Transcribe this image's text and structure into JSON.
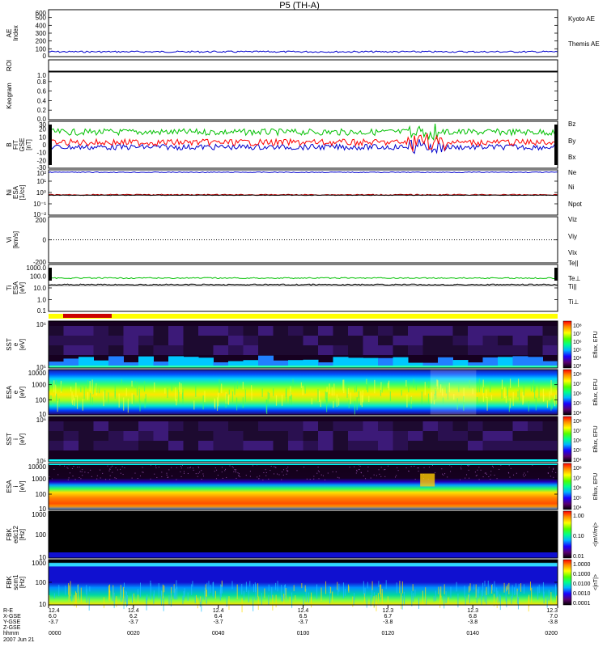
{
  "title": "P5 (TH-A)",
  "chart_data": {
    "type": "multi-panel",
    "panels": [
      {
        "id": "ae",
        "ylabel": "AE Index",
        "yticks": [
          "600",
          "500",
          "400",
          "300",
          "200",
          "100",
          "0"
        ],
        "ylim": [
          0,
          600
        ],
        "legend": [
          {
            "label": "Kyoto AE",
            "color": "#0000cc"
          },
          {
            "label": "Themis AE",
            "color": "#000000"
          }
        ]
      },
      {
        "id": "roi",
        "ylabel": "ROI",
        "yticks": [],
        "legend": []
      },
      {
        "id": "keogram",
        "ylabel": "Keogram",
        "yticks": [
          "1.0",
          "0.8",
          "0.6",
          "0.4",
          "0.2",
          "0.0"
        ],
        "ylim": [
          0,
          1
        ],
        "legend": []
      },
      {
        "id": "bfgm",
        "ylabel": "B FIT GSE [nT]",
        "yticks": [
          "30",
          "20",
          "10",
          "0",
          "-10",
          "-20",
          "-30"
        ],
        "ylim": [
          -30,
          30
        ],
        "legend": [
          {
            "label": "Bz",
            "color": "#ff0000"
          },
          {
            "label": "By",
            "color": "#00c000"
          },
          {
            "label": "Bx",
            "color": "#0000cc"
          }
        ]
      },
      {
        "id": "ni",
        "ylabel": "Ni ESA [1/cc]",
        "yticks": [
          "10²",
          "10¹",
          "10⁰",
          "10⁻¹",
          "10⁻²"
        ],
        "legend": [
          {
            "label": "Ne",
            "color": "#ff0000"
          },
          {
            "label": "Ni",
            "color": "#000000"
          },
          {
            "label": "Npot",
            "color": "#0000cc"
          }
        ]
      },
      {
        "id": "vi",
        "ylabel": "Vi [km/s]",
        "yticks": [
          "200",
          "0",
          "-200"
        ],
        "legend": [
          {
            "label": "Viz",
            "color": "#ff0000"
          },
          {
            "label": "Viy",
            "color": "#00c000"
          },
          {
            "label": "Vix",
            "color": "#0000cc"
          }
        ]
      },
      {
        "id": "ti",
        "ylabel": "Ti ESA [eV]",
        "yticks": [
          "1000.0",
          "100.0",
          "10.0",
          "1.0",
          "0.1"
        ],
        "legend": [
          {
            "label": "Te||",
            "color": "#000000"
          },
          {
            "label": "Te⊥",
            "color": "#ff0000"
          },
          {
            "label": "Ti||",
            "color": "#00c000"
          },
          {
            "label": "Ti⊥",
            "color": "#0000cc"
          }
        ]
      },
      {
        "id": "sst_e",
        "ylabel": "SST e [eV]",
        "yticks": [
          "10⁶",
          "10⁵"
        ],
        "cbar_label": "Eflux, EFU",
        "cbar_ticks": [
          "10⁸",
          "10⁷",
          "10⁶",
          "10⁵",
          "10⁴",
          "10³"
        ]
      },
      {
        "id": "esa_e",
        "ylabel": "ESA e [eV]",
        "yticks": [
          "10000",
          "1000",
          "100",
          "10"
        ],
        "cbar_label": "Eflux, EFU",
        "cbar_ticks": [
          "10⁸",
          "10⁷",
          "10⁶",
          "10⁵",
          "10⁴"
        ]
      },
      {
        "id": "sst_i",
        "ylabel": "SST i [eV]",
        "yticks": [
          "10⁶",
          "10⁵"
        ],
        "cbar_label": "Eflux, EFU",
        "cbar_ticks": [
          "10⁸",
          "10⁷",
          "10⁶",
          "10⁵",
          "10⁴"
        ]
      },
      {
        "id": "esa_i",
        "ylabel": "ESA i [eV]",
        "yticks": [
          "10000",
          "1000",
          "100",
          "10"
        ],
        "cbar_label": "Eflux, EFU",
        "cbar_ticks": [
          "10⁸",
          "10⁷",
          "10⁶",
          "10⁵",
          "10⁴"
        ]
      },
      {
        "id": "fbk_edc",
        "ylabel": "FBK edc12 [Hz]",
        "yticks": [
          "1000",
          "100",
          "10"
        ],
        "cbar_label": "<|mV/m|>",
        "cbar_ticks": [
          "1.00",
          "0.10",
          "0.01"
        ]
      },
      {
        "id": "fbk_scm",
        "ylabel": "FBK scm1 [Hz]",
        "yticks": [
          "1000",
          "100",
          "10"
        ],
        "cbar_label": "<|nT|>",
        "cbar_ticks": [
          "1.0000",
          "0.1000",
          "0.0100",
          "0.0010",
          "0.0001"
        ]
      }
    ],
    "xaxis": {
      "row_labels": [
        "R-E",
        "X-GSE",
        "Y-GSE",
        "Z-GSE",
        "hhmm",
        "2007 Jun 21"
      ],
      "ticks": [
        {
          "r": "12.4",
          "x": "6.0",
          "y": "-3.7",
          "z": "",
          "hhmm": "0000"
        },
        {
          "r": "12.4",
          "x": "6.2",
          "y": "-3.7",
          "z": "",
          "hhmm": "0020"
        },
        {
          "r": "12.4",
          "x": "6.4",
          "y": "-3.7",
          "z": "",
          "hhmm": "0040"
        },
        {
          "r": "12.4",
          "x": "6.5",
          "y": "-3.7",
          "z": "",
          "hhmm": "0100"
        },
        {
          "r": "12.3",
          "x": "6.7",
          "y": "-3.8",
          "z": "",
          "hhmm": "0120"
        },
        {
          "r": "12.3",
          "x": "6.8",
          "y": "-3.8",
          "z": "",
          "hhmm": "0140"
        },
        {
          "r": "12.3",
          "x": "7.0",
          "y": "-3.8",
          "z": "",
          "hhmm": "0200"
        }
      ]
    }
  }
}
